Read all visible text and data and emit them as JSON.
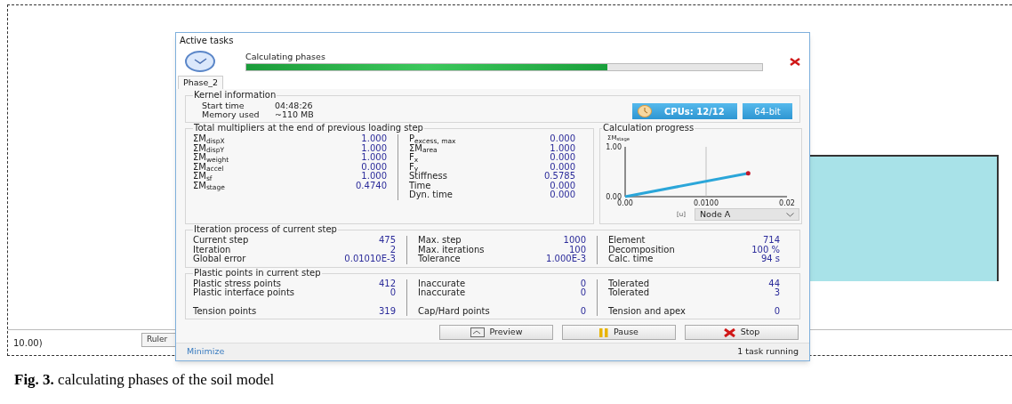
{
  "background": {
    "coordinate": "10.00)",
    "ruler_button": "Ruler"
  },
  "dialog": {
    "title": "Active tasks",
    "task": {
      "label": "Calculating phases",
      "level": 0.7
    },
    "tabs": [
      {
        "label": "Phase_2",
        "selected": true
      }
    ],
    "kernel": {
      "title": "Kernel information",
      "rows": [
        {
          "label": "Start time",
          "value": "04:48:26"
        },
        {
          "label": "Memory used",
          "value": "~110 MB"
        }
      ],
      "cpus": "CPUs: 12/12",
      "bits": "64-bit"
    },
    "multipliers": {
      "title": "Total multipliers at the end of previous loading step",
      "columns": [
        [
          {
            "label": "ΣM$_{dispX}$",
            "value": "1.000"
          },
          {
            "label": "ΣM$_{dispY}$",
            "value": "1.000"
          },
          {
            "label": "ΣM$_{weight}$",
            "value": "1.000"
          },
          {
            "label": "ΣM$_{accel}$",
            "value": "0.000"
          },
          {
            "label": "ΣM$_{sf}$",
            "value": "1.000"
          },
          {
            "label": "ΣM$_{stage}$",
            "value": "0.4740"
          }
        ],
        [
          {
            "label": "P$_{excess, max}$",
            "value": "0.000"
          },
          {
            "label": "ΣM$_{area}$",
            "value": "1.000"
          },
          {
            "label": "F$_{x}$",
            "value": "0.000"
          },
          {
            "label": "F$_{y}$",
            "value": "0.000"
          },
          {
            "label": "Stiffness",
            "value": "0.5785"
          },
          {
            "label": "Time",
            "value": "0.000"
          },
          {
            "label": "Dyn. time",
            "value": "0.000"
          }
        ]
      ]
    },
    "progress": {
      "chart_data": {
        "type": "line",
        "title": "Calculation progress",
        "ylabel": "ΣM$_{stage}$",
        "xlabel": "[u]",
        "x": [
          0,
          0.0152
        ],
        "series": [
          {
            "name": "Node A",
            "color": "#2ba6d9",
            "values": [
              0,
              0.47
            ]
          }
        ],
        "xlim": [
          0,
          0.02
        ],
        "ylim": [
          0,
          1
        ],
        "xticks": [
          {
            "value": 0,
            "label": "0.00"
          },
          {
            "value": 0.01,
            "label": "0.0100"
          },
          {
            "value": 0.02,
            "label": "0.02"
          }
        ],
        "yticks": [
          {
            "value": 0,
            "label": "0.00"
          },
          {
            "value": 1,
            "label": "1.00"
          }
        ]
      }
    },
    "iteration": {
      "title": "Iteration process of current step",
      "columns": [
        [
          {
            "label": "Current step",
            "value": "475"
          },
          {
            "label": "Iteration",
            "value": "2"
          },
          {
            "label": "Global error",
            "value": "0.01010E-3"
          }
        ],
        [
          {
            "label": "Max. step",
            "value": "1000"
          },
          {
            "label": "Max. iterations",
            "value": "100"
          },
          {
            "label": "Tolerance",
            "value": "1.000E-3"
          }
        ],
        [
          {
            "label": "Element",
            "value": "714"
          },
          {
            "label": "Decomposition",
            "value": "100 %"
          },
          {
            "label": "Calc. time",
            "value": "94 s"
          }
        ]
      ]
    },
    "plastic": {
      "title": "Plastic points in current step",
      "columns": [
        [
          {
            "label": "Plastic stress points",
            "value": "412"
          },
          {
            "label": "Plastic interface points",
            "value": "0"
          },
          {
            "label": "Tension points",
            "value": "319"
          }
        ],
        [
          {
            "label": "Inaccurate",
            "value": "0"
          },
          {
            "label": "Inaccurate",
            "value": "0"
          },
          {
            "label": "Cap/Hard points",
            "value": "0"
          }
        ],
        [
          {
            "label": "Tolerated",
            "value": "44"
          },
          {
            "label": "Tolerated",
            "value": "3"
          },
          {
            "label": "Tension and apex",
            "value": "0"
          }
        ]
      ]
    },
    "buttons": [
      {
        "label": "Preview",
        "kind": "preview"
      },
      {
        "label": "Pause",
        "kind": "pause"
      },
      {
        "label": "Stop",
        "kind": "stop"
      }
    ],
    "footer": {
      "minimize": "Minimize",
      "status": "1 task running"
    }
  },
  "caption": "**Fig. 3.** calculating phases of the soil model"
}
